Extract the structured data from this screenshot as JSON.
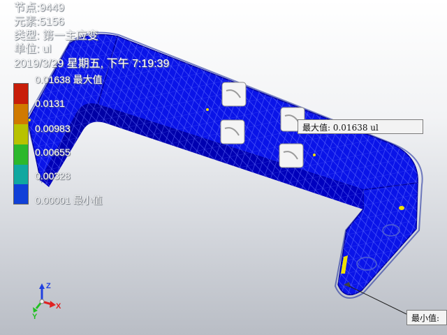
{
  "info": {
    "nodes": "节点:9449",
    "elements": "元素:5156",
    "type": "类型: 第一主应变",
    "unit": "单位: ul",
    "datetime": "2019/3/29 星期五, 下午 7:19:39"
  },
  "legend": {
    "labels": [
      "0.01638 最大值",
      "0.0131",
      "0.00983",
      "0.00655",
      "0.00328",
      "0.00001 最小值"
    ],
    "colors": [
      "#c81e0a",
      "#d07a00",
      "#b8c200",
      "#2cb82c",
      "#10a8a0",
      "#1040d8"
    ]
  },
  "probes": {
    "max_label": "最大值: 0.01638 ul",
    "min_label": "最小值:"
  },
  "triad": {
    "x": "X",
    "y": "Y",
    "z": "Z"
  },
  "colors": {
    "model_blue": "#0a14e8",
    "hotspot_yellow": "#f0e000",
    "text": "#ffffff"
  }
}
